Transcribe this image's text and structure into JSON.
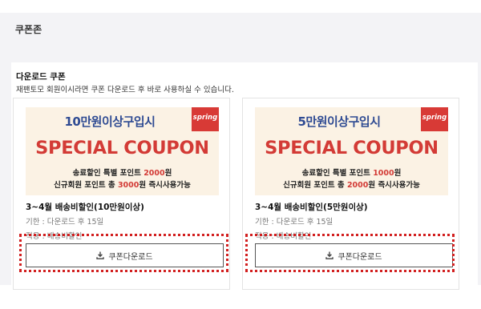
{
  "zone": {
    "title": "쿠폰존"
  },
  "section": {
    "title": "다운로드 쿠폰",
    "description": "재팬토모 회원이시라면 쿠폰 다운로드 후 바로 사용하실 수 있습니다."
  },
  "coupons": [
    {
      "banner": {
        "amount_text": "10만원이상구입시",
        "badge": "spring",
        "headline": "SPECIAL COUPON",
        "line1_prefix": "송료할인 특별 포인트 ",
        "line1_highlight": "2000",
        "line1_suffix": "원",
        "line2_prefix": "신규회원 포인트 총 ",
        "line2_highlight": "3000",
        "line2_suffix": "원 즉시사용가능"
      },
      "title": "3~4월 배송비할인(10만원이상)",
      "period": "기한 : 다운로드 후 15일",
      "applies": "적용 : 배송비할인",
      "button_label": "쿠폰다운로드"
    },
    {
      "banner": {
        "amount_text": "5만원이상구입시",
        "badge": "spring",
        "headline": "SPECIAL COUPON",
        "line1_prefix": "송료할인 특별 포인트 ",
        "line1_highlight": "1000",
        "line1_suffix": "원",
        "line2_prefix": "신규회원 포인트 총 ",
        "line2_highlight": "2000",
        "line2_suffix": "원 즉시사용가능"
      },
      "title": "3~4월 배송비할인(5만원이상)",
      "period": "기한 : 다운로드 후 15일",
      "applies": "적용 : 배송비할인",
      "button_label": "쿠폰다운로드"
    }
  ],
  "colors": {
    "highlight_red": "#d33b36",
    "amount_blue": "#2f4b93",
    "banner_bg": "#fbf2e4",
    "annotation_dotted_border": "#d21f1f"
  },
  "icons": {
    "download_button": "download-icon"
  }
}
